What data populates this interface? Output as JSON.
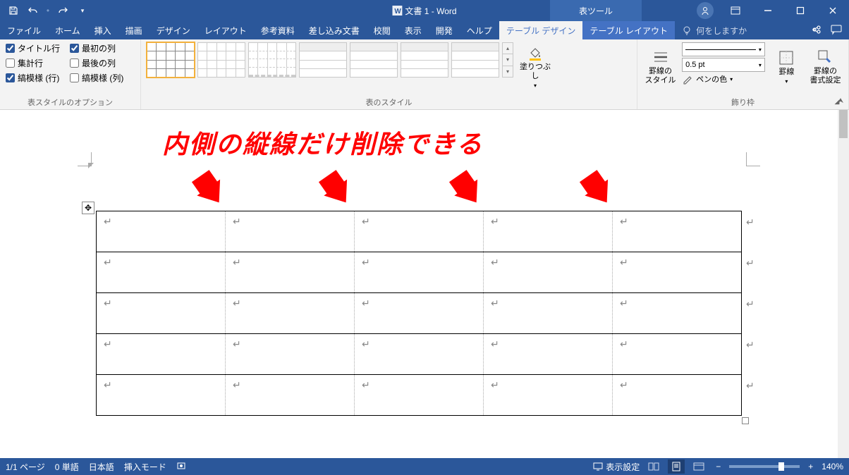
{
  "titlebar": {
    "doc_title": "文書 1 - Word",
    "context_tool": "表ツール"
  },
  "tabs": {
    "file": "ファイル",
    "home": "ホーム",
    "insert": "挿入",
    "draw": "描画",
    "design": "デザイン",
    "layout": "レイアウト",
    "references": "参考資料",
    "mailings": "差し込み文書",
    "review": "校閲",
    "view": "表示",
    "developer": "開発",
    "help": "ヘルプ",
    "table_design": "テーブル デザイン",
    "table_layout": "テーブル レイアウト",
    "tell_me": "何をしますか"
  },
  "ribbon": {
    "style_options": {
      "header_row": "タイトル行",
      "total_row": "集計行",
      "banded_rows": "縞模様 (行)",
      "first_col": "最初の列",
      "last_col": "最後の列",
      "banded_cols": "縞模様 (列)",
      "group_label": "表スタイルのオプション",
      "checked": {
        "header_row": true,
        "total_row": false,
        "banded_rows": true,
        "first_col": true,
        "last_col": false,
        "banded_cols": false
      }
    },
    "table_styles": {
      "group_label": "表のスタイル",
      "shading": "塗りつぶし"
    },
    "borders": {
      "border_styles": "罫線の\nスタイル",
      "pen_weight": "0.5 pt",
      "pen_color": "ペンの色",
      "borders_btn": "罫線",
      "border_painter": "罫線の\n書式設定",
      "group_label": "飾り枠"
    }
  },
  "annotation": {
    "text": "内側の縦線だけ削除できる"
  },
  "statusbar": {
    "page": "1/1 ページ",
    "words": "0 単語",
    "language": "日本語",
    "insert_mode": "挿入モード",
    "display_settings": "表示設定",
    "zoom": "140%"
  }
}
